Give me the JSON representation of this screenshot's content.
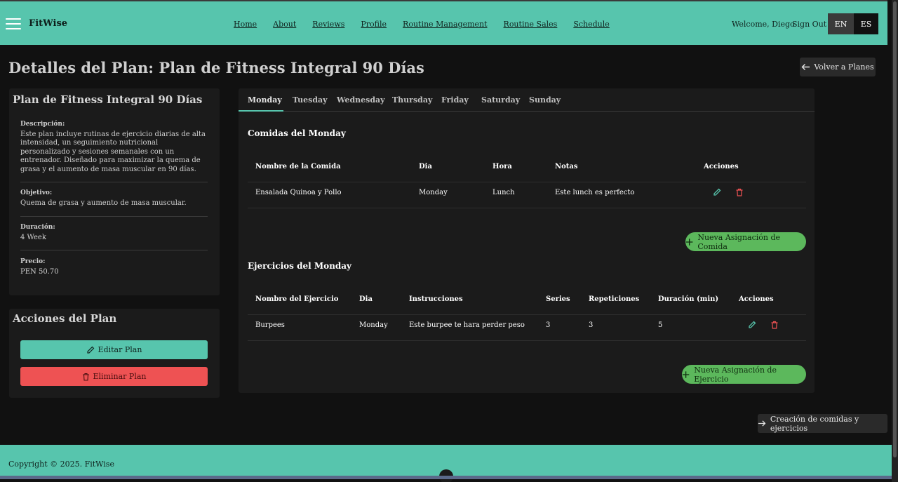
{
  "header": {
    "brand": "FitWise",
    "nav": [
      "Home",
      "About",
      "Reviews",
      "Profile",
      "Routine Management",
      "Routine Sales",
      "Schedule"
    ],
    "welcome": "Welcome, Diego",
    "sign_out": "Sign Out",
    "lang_en": "EN",
    "lang_es": "ES"
  },
  "page": {
    "title": "Detalles del Plan: Plan de Fitness Integral 90 Días",
    "back_button": "Volver a Planes"
  },
  "plan": {
    "name": "Plan de Fitness Integral 90 Días",
    "description_label": "Descripción:",
    "description": "Este plan incluye rutinas de ejercicio diarias de alta intensidad, un seguimiento nutricional personalizado y sesiones semanales con un entrenador. Diseñado para maximizar la quema de grasa y el aumento de masa muscular en 90 días.",
    "objective_label": "Objetivo:",
    "objective": "Quema de grasa y aumento de masa muscular.",
    "duration_label": "Duración:",
    "duration": "4 Week",
    "price_label": "Precio:",
    "price": "PEN 50.70"
  },
  "actions": {
    "title": "Acciones del Plan",
    "edit": "Editar Plan",
    "delete": "Eliminar Plan"
  },
  "tabs": [
    "Monday",
    "Tuesday",
    "Wednesday",
    "Thursday",
    "Friday",
    "Saturday",
    "Sunday"
  ],
  "meals": {
    "title": "Comidas del Monday",
    "headers": [
      "Nombre de la Comida",
      "Dia",
      "Hora",
      "Notas",
      "Acciones"
    ],
    "rows": [
      [
        "Ensalada Quinoa y Pollo",
        "Monday",
        "Lunch",
        "Este lunch es perfecto"
      ]
    ],
    "new_button": "Nueva Asignación de Comida"
  },
  "exercises": {
    "title": "Ejercicios del Monday",
    "headers": [
      "Nombre del Ejercicio",
      "Dia",
      "Instrucciones",
      "Series",
      "Repeticiones",
      "Duración (min)",
      "Acciones"
    ],
    "rows": [
      [
        "Burpees",
        "Monday",
        "Este burpee te hara perder peso",
        "3",
        "3",
        "5"
      ]
    ],
    "new_button": "Nueva Asignación de Ejercicio"
  },
  "create_button": "Creación de comidas y ejercicios",
  "footer": {
    "copyright": "Copyright © 2025. FitWise"
  },
  "icons": {
    "edit": "pencil-icon",
    "delete": "trash-icon",
    "back": "arrow-left-icon",
    "forward": "arrow-right-icon",
    "add": "plus-icon",
    "menu": "hamburger-icon"
  },
  "colors": {
    "accent": "#57c5ad",
    "danger": "#ee5253",
    "success": "#5cb85c"
  }
}
